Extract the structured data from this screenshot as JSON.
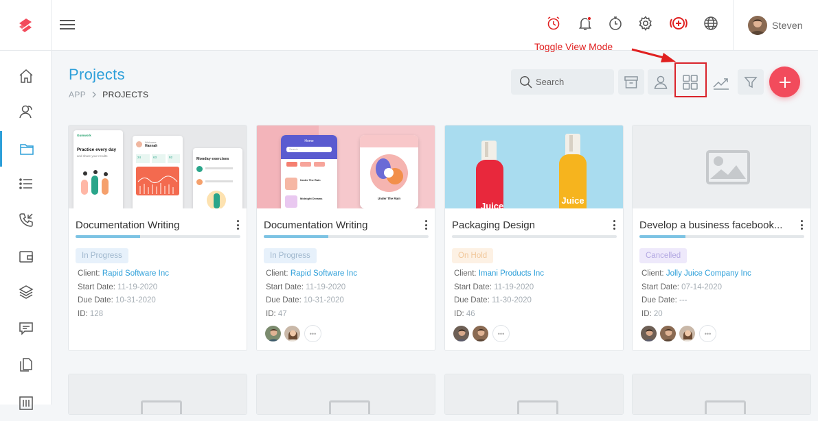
{
  "header": {
    "user_name": "Steven",
    "accent_color": "#2d9fd9",
    "alert_color": "#e02020",
    "icons": [
      "alarm-icon",
      "bell-icon",
      "stopwatch-icon",
      "gear-icon",
      "add-circle-icon",
      "globe-icon"
    ]
  },
  "sidebar": {
    "items": [
      "home-icon",
      "contacts-icon",
      "folder-icon",
      "list-icon",
      "phone-incoming-icon",
      "wallet-icon",
      "layers-icon",
      "chat-icon",
      "documents-icon",
      "sliders-icon"
    ],
    "active_index": 2
  },
  "page": {
    "title": "Projects",
    "breadcrumb": [
      "APP",
      "PROJECTS"
    ]
  },
  "annotation": {
    "label": "Toggle View Mode"
  },
  "toolbar": {
    "search_placeholder": "Search",
    "buttons": [
      "archive-icon",
      "user-icon",
      "grid-view-icon",
      "chart-trend-icon",
      "filter-icon"
    ],
    "add_button": "+"
  },
  "cards": [
    {
      "title": "Documentation Writing",
      "progress": 0.39,
      "status": "In Progress",
      "client_label": "Client:",
      "client": "Rapid Software Inc",
      "start_label": "Start Date:",
      "start": "11-19-2020",
      "due_label": "Due Date:",
      "due": "10-31-2020",
      "id_label": "ID:",
      "id": "128",
      "members": 0
    },
    {
      "title": "Documentation Writing",
      "progress": 0.39,
      "status": "In Progress",
      "client_label": "Client:",
      "client": "Rapid Software Inc",
      "start_label": "Start Date:",
      "start": "11-19-2020",
      "due_label": "Due Date:",
      "due": "10-31-2020",
      "id_label": "ID:",
      "id": "47",
      "members": 2
    },
    {
      "title": "Packaging Design",
      "progress": 0.0,
      "status": "On Hold",
      "client_label": "Client:",
      "client": "Imani Products Inc",
      "start_label": "Start Date:",
      "start": "11-19-2020",
      "due_label": "Due Date:",
      "due": "11-30-2020",
      "id_label": "ID:",
      "id": "46",
      "members": 2
    },
    {
      "title": "Develop a business facebook...",
      "progress": 0.28,
      "status": "Cancelled",
      "client_label": "Client:",
      "client": "Jolly Juice Company Inc",
      "start_label": "Start Date:",
      "start": "07-14-2020",
      "due_label": "Due Date:",
      "due": "---",
      "id_label": "ID:",
      "id": "20",
      "members": 3
    }
  ],
  "mockups": {
    "card1": {
      "brand": "Gumwork",
      "headline": "Practice every day",
      "sub": "and share your results",
      "greeting": "Welcome",
      "user": "Hannah",
      "stats": [
        "24",
        "63",
        "92"
      ],
      "panel": "Monday exercises"
    },
    "card2": {
      "app": "Home",
      "search": "Search",
      "song": "Under The Rain",
      "song2": "Midnight Dreams"
    },
    "card3": {
      "bottle_label": "Juice"
    }
  }
}
